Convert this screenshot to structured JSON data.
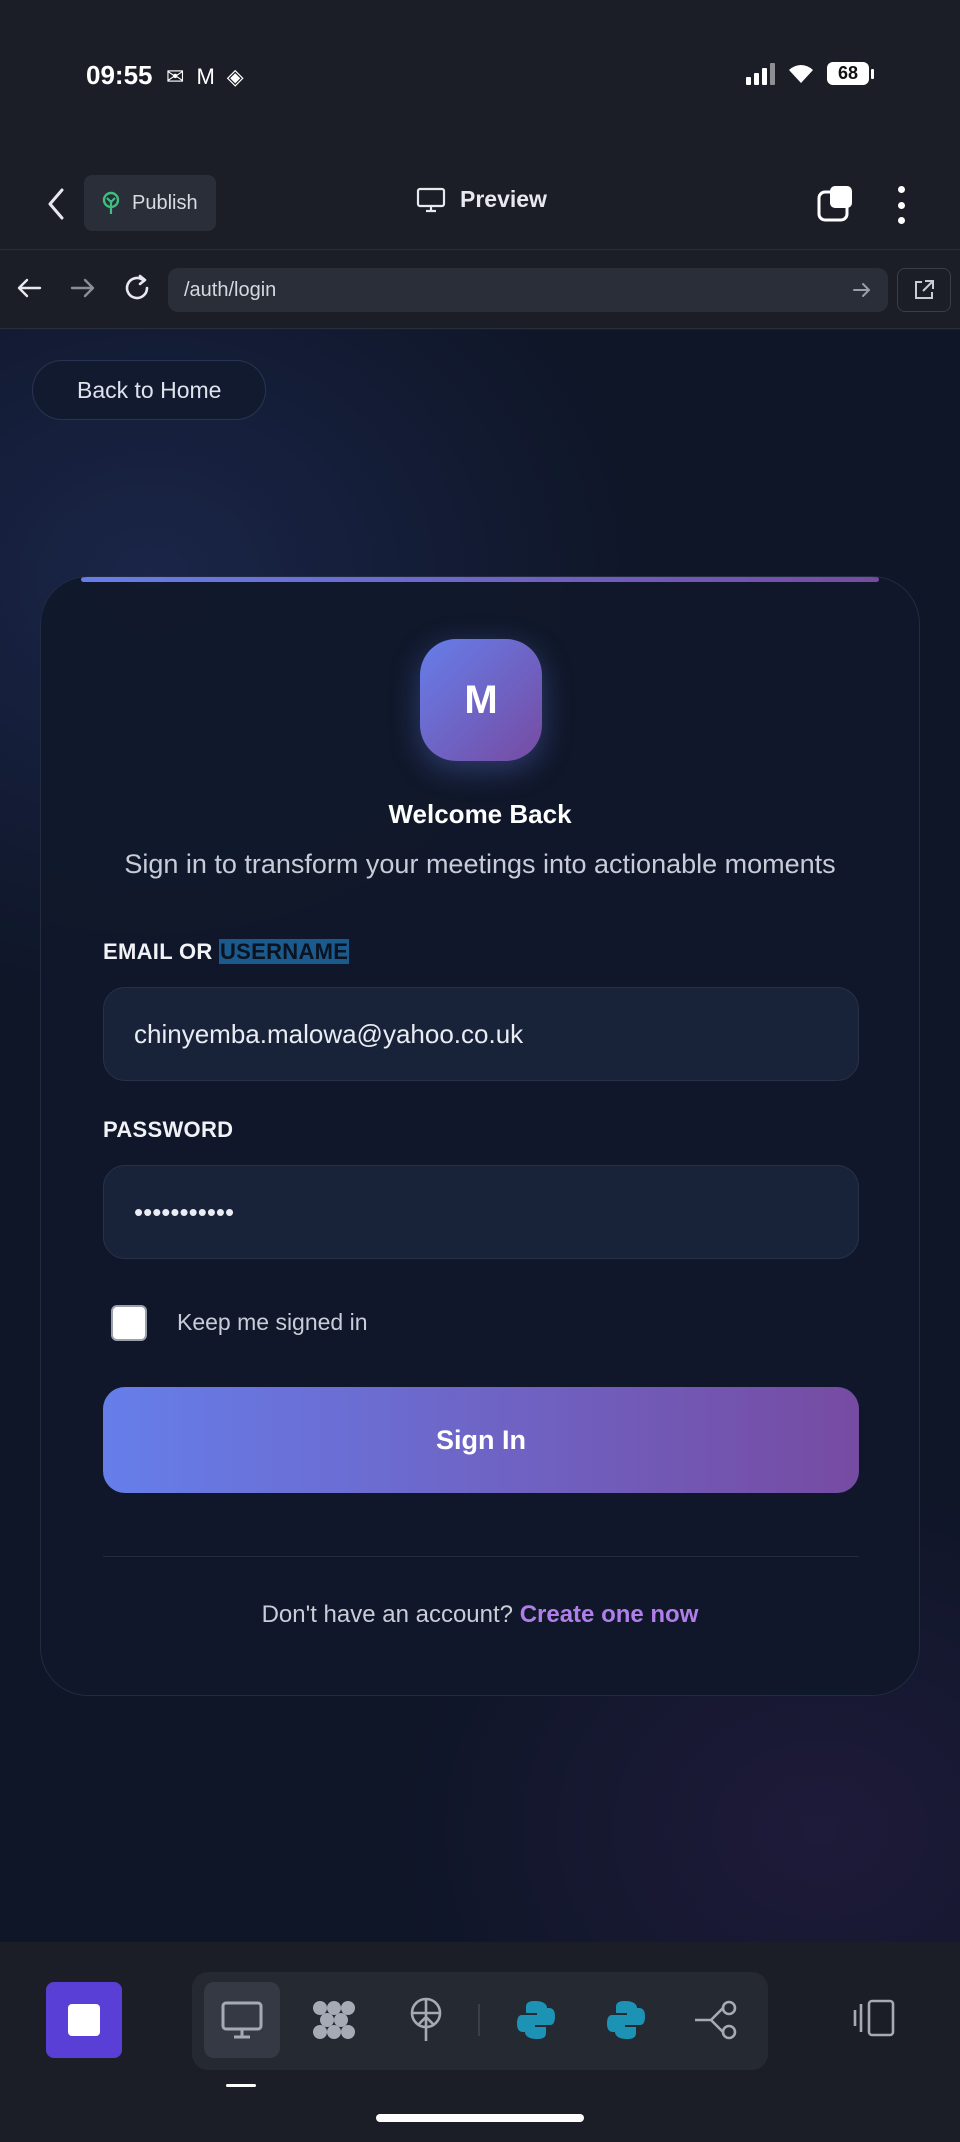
{
  "status_bar": {
    "time": "09:55",
    "battery": "68"
  },
  "app_toolbar": {
    "publish_label": "Publish",
    "preview_label": "Preview"
  },
  "browser": {
    "url": "/auth/login"
  },
  "page": {
    "back_home_label": "Back to Home",
    "logo_letter": "M",
    "title": "Welcome Back",
    "subtitle": "Sign in to transform your meetings into actionable moments",
    "email_label_prefix": "EMAIL OR ",
    "email_label_highlight": "USERNAME",
    "email_value": "chinyemba.malowa@yahoo.co.uk",
    "password_label": "PASSWORD",
    "password_value": "•••••••••••",
    "remember_label": "Keep me signed in",
    "remember_checked": false,
    "signin_label": "Sign In",
    "footer_prompt": "Don't have an account? ",
    "footer_link": "Create one now"
  },
  "colors": {
    "accent_start": "#667eea",
    "accent_end": "#764ba2",
    "link": "#b07ee8",
    "stop_button": "#5a3fd6"
  },
  "dock": {
    "icons": [
      "monitor-icon",
      "grid-blob-icon",
      "globe-antenna-icon",
      "python-icon",
      "python-icon",
      "branch-icon"
    ]
  }
}
